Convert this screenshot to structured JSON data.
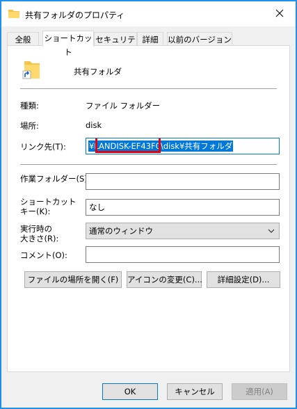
{
  "window": {
    "title": "共有フォルダのプロパティ"
  },
  "tabs": [
    {
      "label": "全般"
    },
    {
      "label": "ショートカット"
    },
    {
      "label": "セキュリティ"
    },
    {
      "label": "詳細"
    },
    {
      "label": "以前のバージョン"
    }
  ],
  "header": {
    "name": "共有フォルダ"
  },
  "props": {
    "type_label": "種類:",
    "type_value": "ファイル フォルダー",
    "location_label": "場所:",
    "location_value": "disk",
    "target_label": "リンク先(T):",
    "target_prefix": "¥",
    "target_value": "LANDISK-EF43F0\\disk¥共有フォルダ",
    "workdir_label": "作業フォルダー(S):",
    "workdir_value": "",
    "shortcut_label_1": "ショートカット",
    "shortcut_label_2": "キー(K):",
    "shortcut_value": "なし",
    "run_label_1": "実行時の",
    "run_label_2": "大きさ(R):",
    "run_value": "通常のウィンドウ",
    "comment_label": "コメント(O):",
    "comment_value": ""
  },
  "actions": {
    "open_location": "ファイルの場所を開く(F)",
    "change_icon": "アイコンの変更(C)...",
    "advanced": "詳細設定(D)..."
  },
  "footer": {
    "ok": "OK",
    "cancel": "キャンセル",
    "apply": "適用(A)"
  },
  "colors": {
    "accent": "#0078d7",
    "highlight_box": "#e3000f",
    "folder": "#f3c34a"
  }
}
